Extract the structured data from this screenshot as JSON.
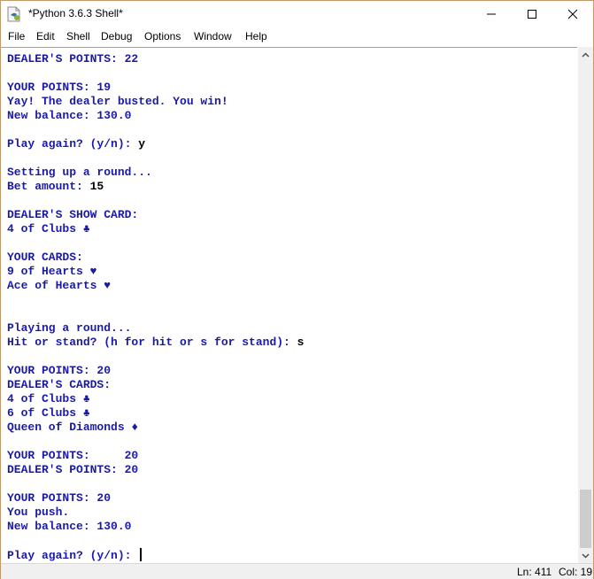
{
  "window": {
    "title": "*Python 3.6.3 Shell*",
    "icon": "python-idle-icon",
    "controls": {
      "minimize": "minimize-icon",
      "maximize": "maximize-icon",
      "close": "close-icon"
    }
  },
  "menu": [
    "File",
    "Edit",
    "Shell",
    "Debug",
    "Options",
    "Window",
    "Help"
  ],
  "shell": {
    "colors": {
      "output": "#1a1aa8",
      "input": "#000000"
    },
    "lines": [
      {
        "out": "DEALER'S POINTS: 22",
        "in": ""
      },
      {
        "out": "",
        "in": ""
      },
      {
        "out": "YOUR POINTS: 19",
        "in": ""
      },
      {
        "out": "Yay! The dealer busted. You win!",
        "in": ""
      },
      {
        "out": "New balance: 130.0",
        "in": ""
      },
      {
        "out": "",
        "in": ""
      },
      {
        "out": "Play again? (y/n): ",
        "in": "y"
      },
      {
        "out": "",
        "in": ""
      },
      {
        "out": "Setting up a round...",
        "in": ""
      },
      {
        "out": "Bet amount: ",
        "in": "15"
      },
      {
        "out": "",
        "in": ""
      },
      {
        "out": "DEALER'S SHOW CARD:",
        "in": ""
      },
      {
        "out": "4 of Clubs ♣",
        "in": ""
      },
      {
        "out": "",
        "in": ""
      },
      {
        "out": "YOUR CARDS:",
        "in": ""
      },
      {
        "out": "9 of Hearts ♥",
        "in": ""
      },
      {
        "out": "Ace of Hearts ♥",
        "in": ""
      },
      {
        "out": "",
        "in": ""
      },
      {
        "out": "",
        "in": ""
      },
      {
        "out": "Playing a round...",
        "in": ""
      },
      {
        "out": "Hit or stand? (h for hit or s for stand): ",
        "in": "s"
      },
      {
        "out": "",
        "in": ""
      },
      {
        "out": "YOUR POINTS: 20",
        "in": ""
      },
      {
        "out": "DEALER'S CARDS:",
        "in": ""
      },
      {
        "out": "4 of Clubs ♣",
        "in": ""
      },
      {
        "out": "6 of Clubs ♣",
        "in": ""
      },
      {
        "out": "Queen of Diamonds ♦",
        "in": ""
      },
      {
        "out": "",
        "in": ""
      },
      {
        "out": "YOUR POINTS:     20",
        "in": ""
      },
      {
        "out": "DEALER'S POINTS: 20",
        "in": ""
      },
      {
        "out": "",
        "in": ""
      },
      {
        "out": "YOUR POINTS: 20",
        "in": ""
      },
      {
        "out": "You push.",
        "in": ""
      },
      {
        "out": "New balance: 130.0",
        "in": ""
      },
      {
        "out": "",
        "in": ""
      },
      {
        "out": "Play again? (y/n): ",
        "in": "",
        "cursor": true
      }
    ]
  },
  "scrollbar": {
    "position_fraction": 1.0,
    "visible_fraction": 0.12
  },
  "status": {
    "line": "Ln: 411",
    "col": "Col: 19"
  }
}
